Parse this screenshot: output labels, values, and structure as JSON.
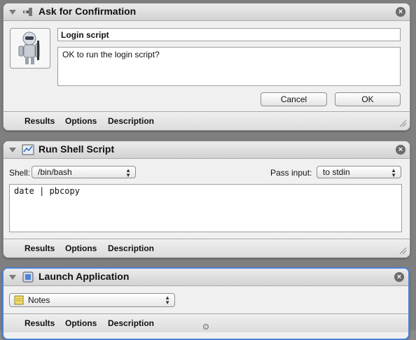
{
  "actions": [
    {
      "title": "Ask for Confirmation",
      "icon": "automator-robot-icon",
      "message_title": "Login script",
      "message_body": "OK to run the login script?",
      "cancel_label": "Cancel",
      "ok_label": "OK",
      "tabs": [
        "Results",
        "Options",
        "Description"
      ]
    },
    {
      "title": "Run Shell Script",
      "icon": "terminal-script-icon",
      "shell_label": "Shell:",
      "shell_value": "/bin/bash",
      "pass_input_label": "Pass input:",
      "pass_input_value": "to stdin",
      "script": "date | pbcopy",
      "tabs": [
        "Results",
        "Options",
        "Description"
      ]
    },
    {
      "title": "Launch Application",
      "icon": "application-icon",
      "app_value": "Notes",
      "tabs": [
        "Results",
        "Options",
        "Description"
      ]
    }
  ],
  "close_glyph": "×",
  "colors": {
    "selected_border": "#4a84d8",
    "canvas": "#7f7f7f"
  }
}
